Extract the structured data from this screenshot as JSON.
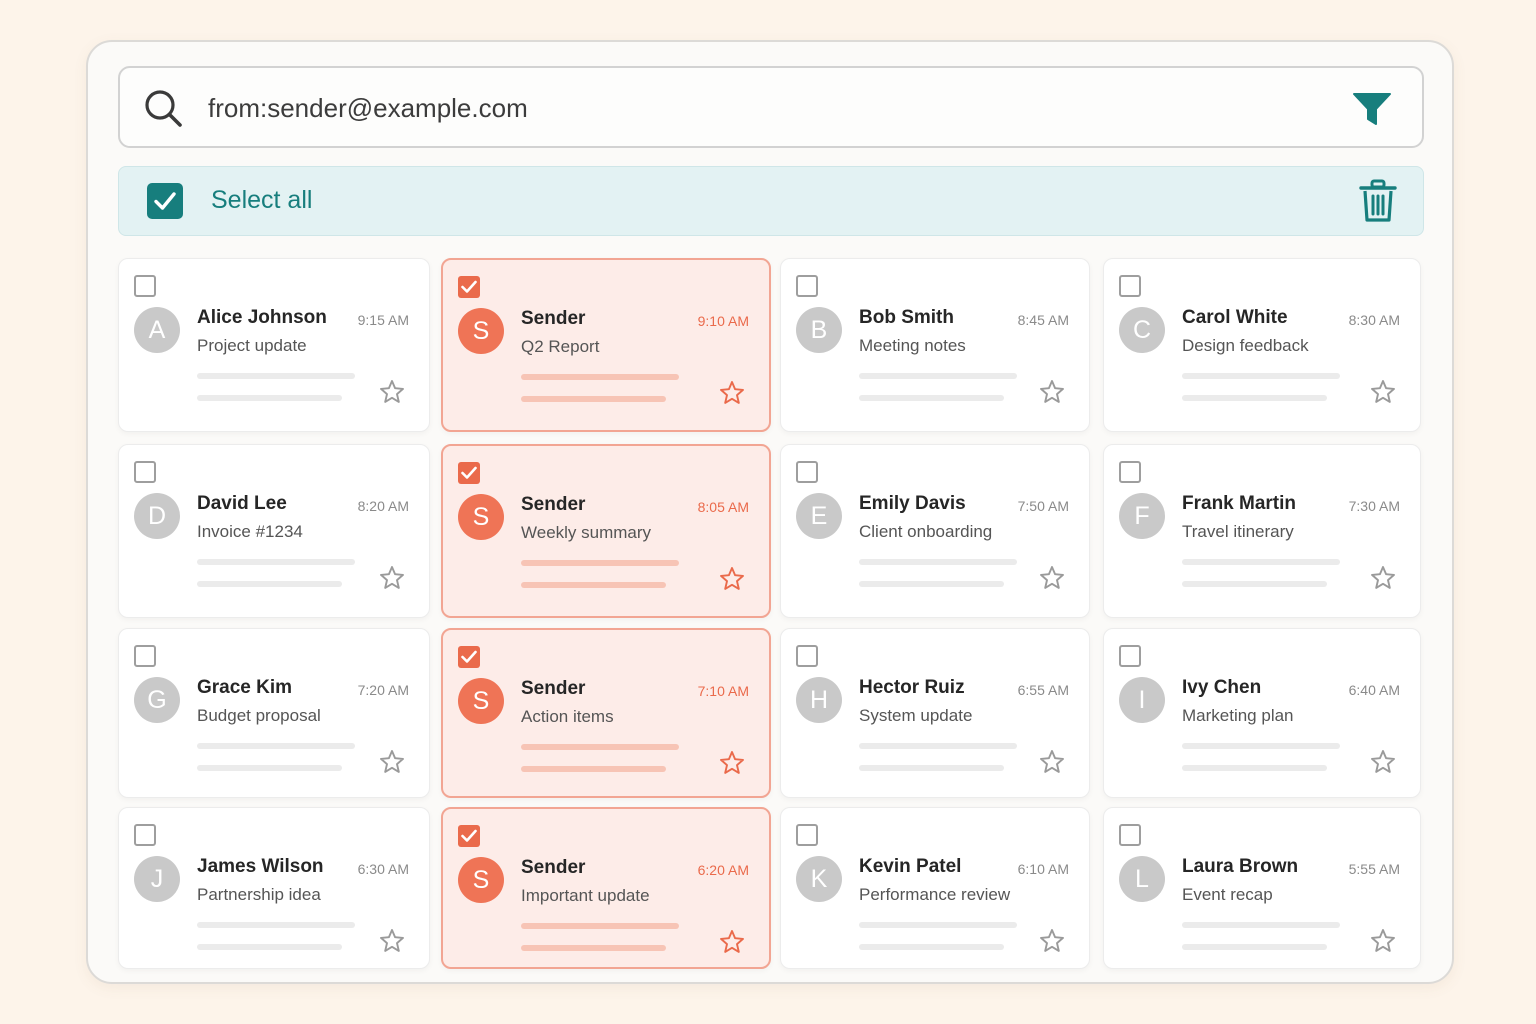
{
  "search": {
    "value": "from:sender@example.com",
    "icon": "search-icon",
    "filter_icon": "filter-icon"
  },
  "selection": {
    "label": "Select all",
    "checked": true,
    "delete_icon": "trash-icon"
  },
  "colors": {
    "accent": "#177e7d",
    "selected": "#ea6a4b",
    "selected_bg": "#fdece8"
  },
  "messages": [
    {
      "initial": "A",
      "sender": "Alice Johnson",
      "subject": "Project update",
      "time": "9:15 AM",
      "selected": false
    },
    {
      "initial": "S",
      "sender": "Sender",
      "subject": "Q2 Report",
      "time": "9:10 AM",
      "selected": true
    },
    {
      "initial": "B",
      "sender": "Bob Smith",
      "subject": "Meeting notes",
      "time": "8:45 AM",
      "selected": false
    },
    {
      "initial": "C",
      "sender": "Carol White",
      "subject": "Design feedback",
      "time": "8:30 AM",
      "selected": false
    },
    {
      "initial": "D",
      "sender": "David Lee",
      "subject": "Invoice #1234",
      "time": "8:20 AM",
      "selected": false
    },
    {
      "initial": "S",
      "sender": "Sender",
      "subject": "Weekly summary",
      "time": "8:05 AM",
      "selected": true
    },
    {
      "initial": "E",
      "sender": "Emily Davis",
      "subject": "Client onboarding",
      "time": "7:50 AM",
      "selected": false
    },
    {
      "initial": "F",
      "sender": "Frank Martin",
      "subject": "Travel itinerary",
      "time": "7:30 AM",
      "selected": false
    },
    {
      "initial": "G",
      "sender": "Grace Kim",
      "subject": "Budget proposal",
      "time": "7:20 AM",
      "selected": false
    },
    {
      "initial": "S",
      "sender": "Sender",
      "subject": "Action items",
      "time": "7:10 AM",
      "selected": true
    },
    {
      "initial": "H",
      "sender": "Hector Ruiz",
      "subject": "System update",
      "time": "6:55 AM",
      "selected": false
    },
    {
      "initial": "I",
      "sender": "Ivy Chen",
      "subject": "Marketing plan",
      "time": "6:40 AM",
      "selected": false
    },
    {
      "initial": "J",
      "sender": "James Wilson",
      "subject": "Partnership idea",
      "time": "6:30 AM",
      "selected": false
    },
    {
      "initial": "S",
      "sender": "Sender",
      "subject": "Important update",
      "time": "6:20 AM",
      "selected": true
    },
    {
      "initial": "K",
      "sender": "Kevin Patel",
      "subject": "Performance review",
      "time": "6:10 AM",
      "selected": false
    },
    {
      "initial": "L",
      "sender": "Laura Brown",
      "subject": "Event recap",
      "time": "5:55 AM",
      "selected": false
    }
  ]
}
